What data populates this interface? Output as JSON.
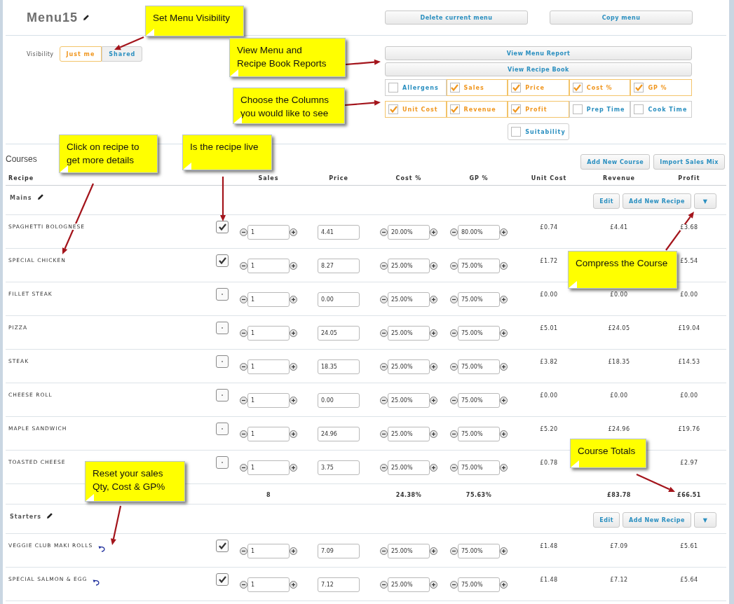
{
  "menu_title": "Menu15",
  "header_buttons": [
    "Delete current menu",
    "Copy menu"
  ],
  "visibility": {
    "label": "Visibility",
    "options": [
      {
        "label": "Just me",
        "selected": true
      },
      {
        "label": "Shared",
        "selected": false
      }
    ]
  },
  "report_buttons": [
    "View Menu Report",
    "View Recipe Book"
  ],
  "column_toggles": [
    {
      "label": "Allergens",
      "checked": false
    },
    {
      "label": "Sales",
      "checked": true
    },
    {
      "label": "Price",
      "checked": true
    },
    {
      "label": "Cost %",
      "checked": true
    },
    {
      "label": "GP %",
      "checked": true
    },
    {
      "label": "Unit Cost",
      "checked": true
    },
    {
      "label": "Revenue",
      "checked": true
    },
    {
      "label": "Profit",
      "checked": true
    },
    {
      "label": "Prep Time",
      "checked": false
    },
    {
      "label": "Cook Time",
      "checked": false
    },
    {
      "label": "Suitability",
      "checked": false
    }
  ],
  "courses_title": "Courses",
  "courses_buttons": [
    "Add New Course",
    "Import Sales Mix"
  ],
  "columns": [
    "Recipe",
    "Sales",
    "Price",
    "Cost %",
    "GP %",
    "Unit Cost",
    "Revenue",
    "Profit"
  ],
  "courses": [
    {
      "name": "Mains",
      "buttons": [
        "Edit",
        "Add New Recipe"
      ],
      "collapse": "▼",
      "recipes": [
        {
          "name": "SPAGHETTI BOLOGNESE",
          "live": true,
          "reset": false,
          "sales": "1",
          "price": "4.41",
          "cost": "20.00%",
          "gp": "80.00%",
          "unit_cost": "£0.74",
          "revenue": "£4.41",
          "profit": "£3.68"
        },
        {
          "name": "SPECIAL CHICKEN",
          "live": true,
          "reset": false,
          "sales": "1",
          "price": "8.27",
          "cost": "25.00%",
          "gp": "75.00%",
          "unit_cost": "£1.72",
          "profit": "£5.54"
        },
        {
          "name": "FILLET STEAK",
          "live": false,
          "reset": false,
          "sales": "1",
          "price": "0.00",
          "cost": "25.00%",
          "gp": "75.00%",
          "unit_cost": "£0.00",
          "revenue": "£0.00",
          "profit": "£0.00"
        },
        {
          "name": "PIZZA",
          "live": false,
          "reset": false,
          "sales": "1",
          "price": "24.05",
          "cost": "25.00%",
          "gp": "75.00%",
          "unit_cost": "£5.01",
          "revenue": "£24.05",
          "profit": "£19.04"
        },
        {
          "name": "STEAK",
          "live": false,
          "reset": false,
          "sales": "1",
          "price": "18.35",
          "cost": "25.00%",
          "gp": "75.00%",
          "unit_cost": "£3.82",
          "revenue": "£18.35",
          "profit": "£14.53"
        },
        {
          "name": "CHEESE ROLL",
          "live": false,
          "reset": false,
          "sales": "1",
          "price": "0.00",
          "cost": "25.00%",
          "gp": "75.00%",
          "unit_cost": "£0.00",
          "revenue": "£0.00",
          "profit": "£0.00"
        },
        {
          "name": "MAPLE SANDWICH",
          "live": false,
          "reset": false,
          "sales": "1",
          "price": "24.96",
          "cost": "25.00%",
          "gp": "75.00%",
          "unit_cost": "£5.20",
          "revenue": "£24.96",
          "profit": "£19.76"
        },
        {
          "name": "TOASTED CHEESE",
          "live": false,
          "reset": false,
          "sales": "1",
          "price": "3.75",
          "cost": "25.00%",
          "gp": "75.00%",
          "unit_cost": "£0.78",
          "profit": "£2.97"
        }
      ],
      "totals": {
        "sales": "8",
        "cost": "24.38%",
        "gp": "75.63%",
        "revenue": "£83.78",
        "profit": "£66.51"
      }
    },
    {
      "name": "Starters",
      "buttons": [
        "Edit",
        "Add New Recipe"
      ],
      "collapse": "▼",
      "recipes": [
        {
          "name": "VEGGIE CLUB MAKI ROLLS",
          "live": true,
          "reset": true,
          "sales": "1",
          "price": "7.09",
          "cost": "25.00%",
          "gp": "75.00%",
          "unit_cost": "£1.48",
          "revenue": "£7.09",
          "profit": "£5.61"
        },
        {
          "name": "SPECIAL SALMON & EGG",
          "live": true,
          "reset": true,
          "sales": "1",
          "price": "7.12",
          "cost": "25.00%",
          "gp": "75.00%",
          "unit_cost": "£1.48",
          "revenue": "£7.12",
          "profit": "£5.64"
        }
      ]
    }
  ],
  "callouts": [
    "Set Menu Visibility",
    "View Menu and\nRecipe Book Reports",
    "Choose the Columns\nyou would like to see",
    "Click on recipe to\nget more details",
    "Is the recipe live",
    "Compress the Course",
    "Course Totals",
    "Reset your sales\nQty, Cost & GP%"
  ]
}
